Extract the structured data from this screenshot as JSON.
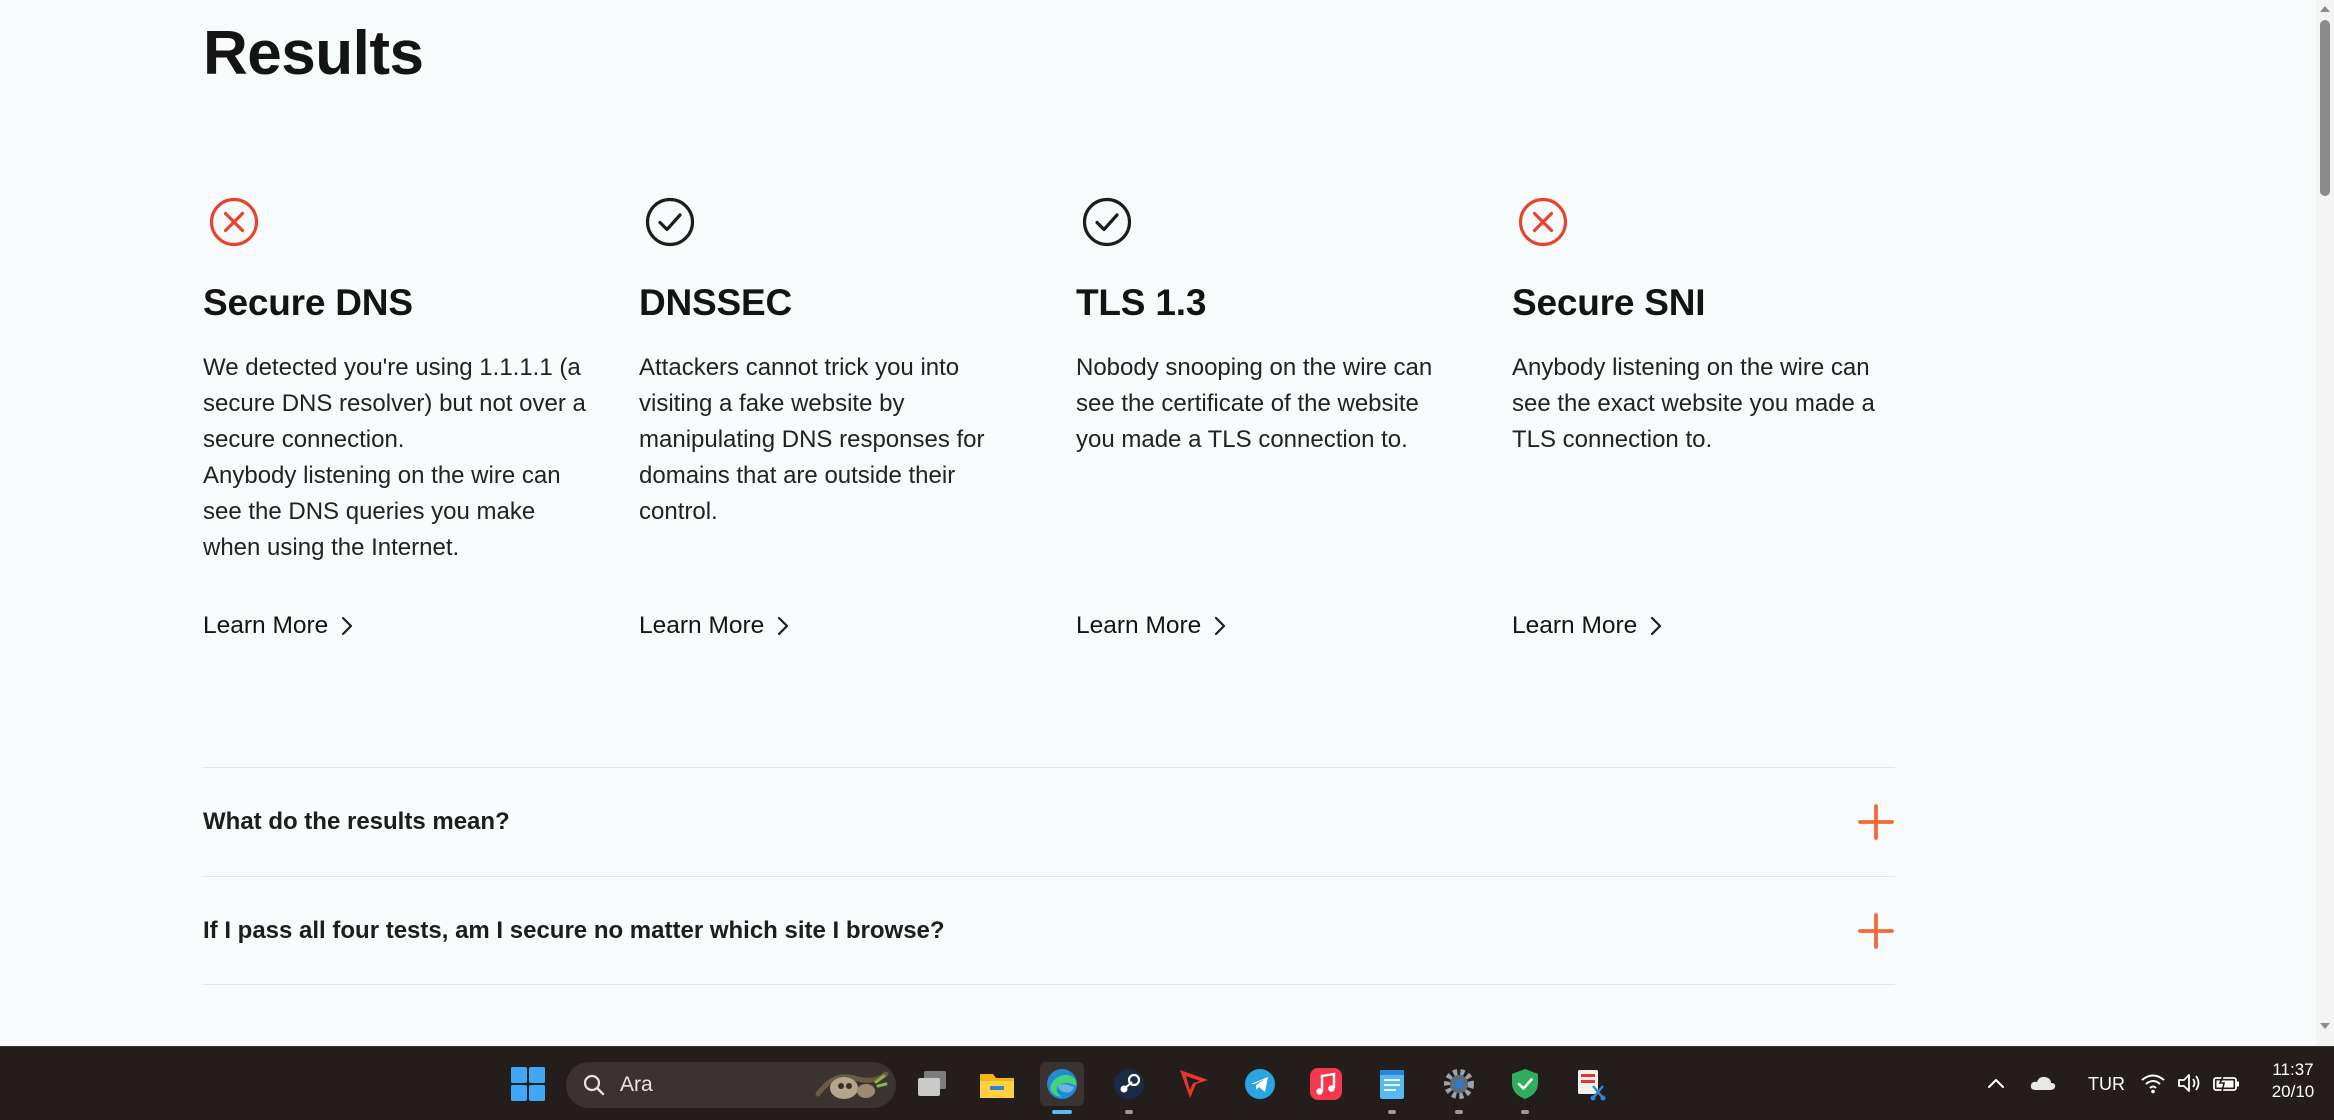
{
  "page": {
    "title": "Results"
  },
  "results": [
    {
      "status": "fail",
      "status_icon": "x-circle-icon",
      "title": "Secure DNS",
      "desc_lines": [
        "We detected you're using 1.1.1.1 (a",
        "secure DNS resolver) but not over a",
        "secure connection.",
        "Anybody listening on the wire can",
        "see the DNS queries you make",
        "when using the Internet."
      ],
      "learn_more": "Learn More"
    },
    {
      "status": "pass",
      "status_icon": "check-circle-icon",
      "title": "DNSSEC",
      "desc_lines": [
        "Attackers cannot trick you into",
        "visiting a fake website by",
        "manipulating DNS responses for",
        "domains that are outside their",
        "control."
      ],
      "learn_more": "Learn More"
    },
    {
      "status": "pass",
      "status_icon": "check-circle-icon",
      "title": "TLS 1.3",
      "desc_lines": [
        "Nobody snooping on the wire can",
        "see the certificate of the website",
        "you made a TLS connection to."
      ],
      "learn_more": "Learn More"
    },
    {
      "status": "fail",
      "status_icon": "x-circle-icon",
      "title": "Secure SNI",
      "desc_lines": [
        "Anybody listening on the wire can",
        "see the exact website you made a",
        "TLS connection to."
      ],
      "learn_more": "Learn More"
    }
  ],
  "faq": [
    {
      "question": "What do the results mean?",
      "icon": "plus-icon"
    },
    {
      "question": "If I pass all four tests, am I secure no matter which site I browse?",
      "icon": "plus-icon"
    }
  ],
  "colors": {
    "fail": "#e8432e",
    "pass": "#1d1d1d",
    "accent": "#f26a3a",
    "background": "#f7fbfb",
    "taskbar": "#231d1b"
  },
  "taskbar": {
    "search_placeholder": "Ara",
    "apps": [
      "windows-start-icon",
      "task-view-icon",
      "file-explorer-icon",
      "edge-browser-icon",
      "steam-icon",
      "media-player-icon",
      "telegram-icon",
      "apple-music-icon",
      "notepad-icon",
      "settings-icon",
      "security-shield-icon",
      "snipping-tool-icon"
    ],
    "tray": {
      "language": "TUR",
      "time": "11:37",
      "date": "20/10"
    }
  }
}
